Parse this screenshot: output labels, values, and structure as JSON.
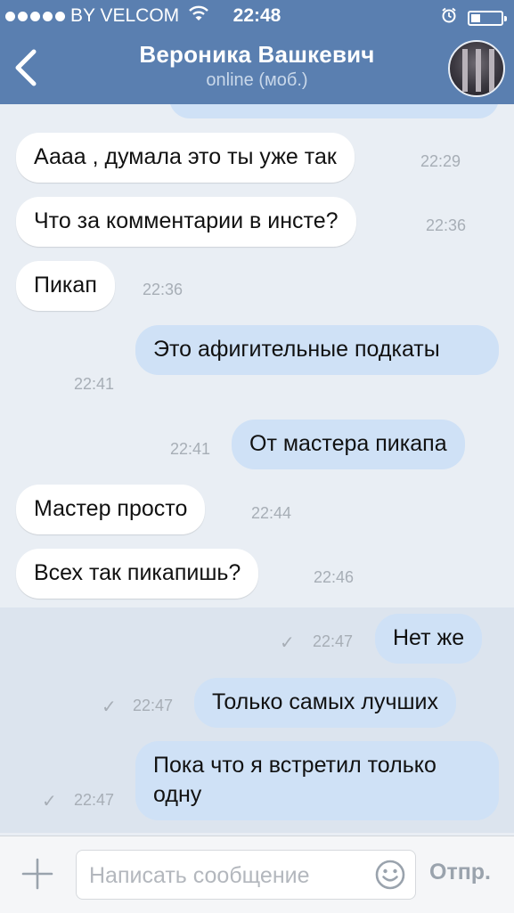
{
  "status_bar": {
    "carrier": "BY VELCOM",
    "time": "22:48",
    "signal_bars": 5,
    "battery_level": 0.3,
    "icons": [
      "wifi-icon",
      "alarm-icon",
      "battery-icon"
    ]
  },
  "header": {
    "contact_name": "Вероника Вашкевич",
    "contact_status": "online (моб.)",
    "back_icon": "chevron-left-icon",
    "bar_color": "#5a7fb0"
  },
  "messages": [
    {
      "direction": "in",
      "text": "Аааа , думала это ты уже так",
      "time": "22:29"
    },
    {
      "direction": "in",
      "text": "Что за комментарии в инсте?",
      "time": "22:36"
    },
    {
      "direction": "in",
      "text": "Пикап",
      "time": "22:36"
    },
    {
      "direction": "out",
      "text": "Это афигительные подкаты",
      "time": "22:41"
    },
    {
      "direction": "out",
      "text": "От мастера пикапа",
      "time": "22:41"
    },
    {
      "direction": "in",
      "text": "Мастер просто",
      "time": "22:44"
    },
    {
      "direction": "in",
      "text": "Всех так пикапишь?",
      "time": "22:46"
    },
    {
      "direction": "out",
      "text": "Нет же",
      "time": "22:47",
      "delivered": true
    },
    {
      "direction": "out",
      "text": "Только самых лучших",
      "time": "22:47",
      "delivered": true
    },
    {
      "direction": "out",
      "text": "Пока что я встретил только одну",
      "time": "22:47",
      "delivered": true
    }
  ],
  "input_bar": {
    "placeholder": "Написать сообщение",
    "send_label": "Отпр.",
    "attach_icon": "plus-icon",
    "emoji_icon": "smile-icon"
  },
  "colors": {
    "outgoing_bubble": "#cfe1f6",
    "incoming_bubble": "#ffffff",
    "chat_background": "#e9eef4"
  }
}
